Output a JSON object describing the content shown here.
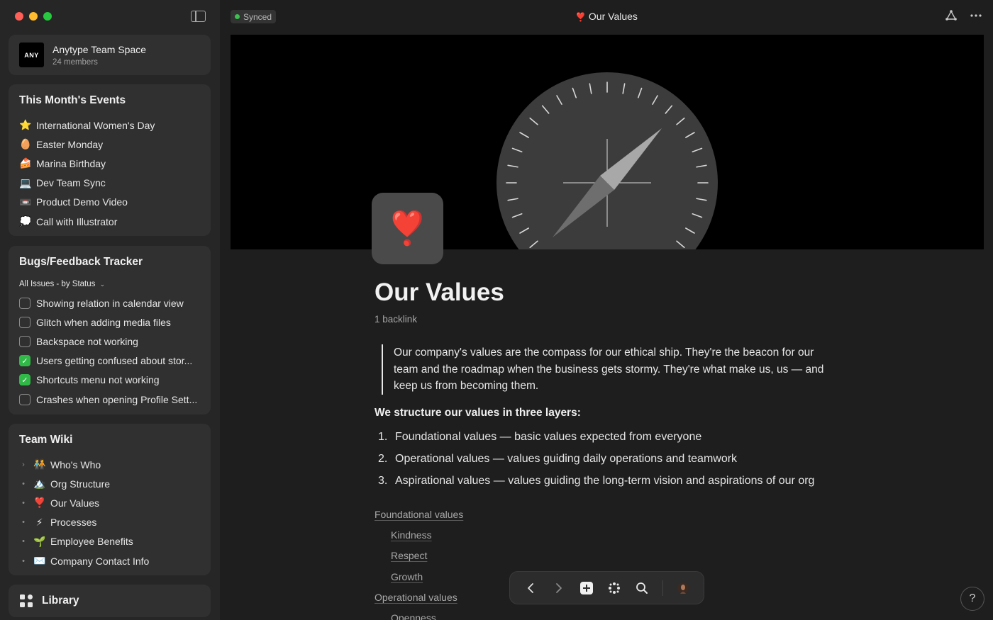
{
  "window": {
    "traffic_colors": [
      "#fe5f57",
      "#febc2e",
      "#28c840"
    ]
  },
  "sidebar": {
    "space": {
      "logo_text": "ANY",
      "name": "Anytype Team Space",
      "members": "24 members"
    },
    "events": {
      "title": "This Month's Events",
      "items": [
        {
          "icon": "⭐",
          "label": "International Women's Day"
        },
        {
          "icon": "🥚",
          "label": "Easter Monday"
        },
        {
          "icon": "🍰",
          "label": "Marina Birthday"
        },
        {
          "icon": "💻",
          "label": "Dev Team Sync"
        },
        {
          "icon": "📼",
          "label": "Product Demo Video"
        },
        {
          "icon": "💭",
          "label": "Call with Illustrator"
        }
      ]
    },
    "bugs": {
      "title": "Bugs/Feedback Tracker",
      "filter": "All Issues - by Status",
      "items": [
        {
          "checked": false,
          "label": "Showing relation in calendar view"
        },
        {
          "checked": false,
          "label": "Glitch when adding media files"
        },
        {
          "checked": false,
          "label": "Backspace not working"
        },
        {
          "checked": true,
          "label": "Users getting confused about stor..."
        },
        {
          "checked": true,
          "label": "Shortcuts menu not working"
        },
        {
          "checked": false,
          "label": "Crashes when opening Profile Sett..."
        }
      ]
    },
    "wiki": {
      "title": "Team Wiki",
      "items": [
        {
          "mark": "›",
          "icon": "🧑‍🤝‍🧑",
          "label": "Who's Who"
        },
        {
          "mark": "•",
          "icon": "🏔️",
          "label": "Org Structure"
        },
        {
          "mark": "•",
          "icon": "❣️",
          "label": "Our Values"
        },
        {
          "mark": "•",
          "icon": "⚡",
          "label": "Processes"
        },
        {
          "mark": "•",
          "icon": "🌱",
          "label": "Employee Benefits"
        },
        {
          "mark": "•",
          "icon": "✉️",
          "label": "Company Contact Info"
        }
      ]
    },
    "library": "Library"
  },
  "header": {
    "status": "Synced",
    "status_color": "#3cc04f",
    "title_icon": "❣️",
    "title": "Our Values"
  },
  "page": {
    "icon": "❣️",
    "heading": "Our Values",
    "backlinks": "1 backlink",
    "quote": "Our company's values are the compass for our ethical ship. They're the beacon for our team and the roadmap when the business gets stormy. They're what make us, us — and keep us from becoming them.",
    "layers_heading": "We structure our values in three layers:",
    "layers": [
      {
        "num": "1.",
        "text": "Foundational values — basic values expected from everyone"
      },
      {
        "num": "2.",
        "text": "Operational values — values guiding daily operations and teamwork"
      },
      {
        "num": "3.",
        "text": "Aspirational values — values guiding the long-term vision and aspirations of our org"
      }
    ],
    "toc": [
      {
        "text": "Foundational values",
        "level": 0
      },
      {
        "text": "Kindness",
        "level": 1
      },
      {
        "text": "Respect",
        "level": 1
      },
      {
        "text": "Growth",
        "level": 1
      },
      {
        "text": "Operational values",
        "level": 0
      },
      {
        "text": "Openness",
        "level": 1
      }
    ]
  },
  "help": "?"
}
